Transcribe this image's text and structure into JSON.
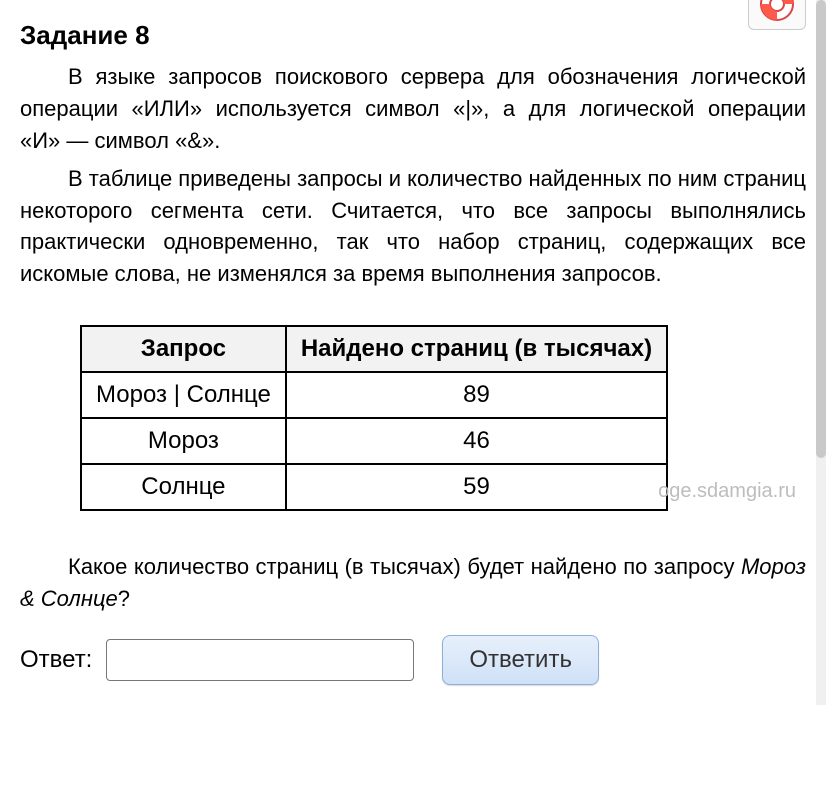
{
  "heading": "Задание 8",
  "paragraphs": {
    "p1": "В языке запросов поискового сервера для обозначения логической операции «ИЛИ» используется символ «|», а для логической операции «И» — символ «&».",
    "p2": "В таблице приведены запросы и количество найденных по ним страниц некоторого сегмента сети. Считается, что все запросы выполнялись практически одновременно, так что набор страниц, содержащих все искомые слова, не изменялся за время выполнения запросов."
  },
  "chart_data": {
    "type": "table",
    "headers": [
      "Запрос",
      "Найдено страниц (в тысячах)"
    ],
    "rows": [
      {
        "query": "Мороз | Солнце",
        "count": "89"
      },
      {
        "query": "Мороз",
        "count": "46"
      },
      {
        "query": "Солнце",
        "count": "59"
      }
    ]
  },
  "watermark": "oge.sdamgia.ru",
  "question": {
    "prefix": "Какое количество страниц (в тысячах) будет найдено по запросу ",
    "italic": "Мороз & Солнце",
    "suffix": "?"
  },
  "answer": {
    "label": "Ответ:",
    "value": "",
    "placeholder": ""
  },
  "submit_label": "Ответить"
}
